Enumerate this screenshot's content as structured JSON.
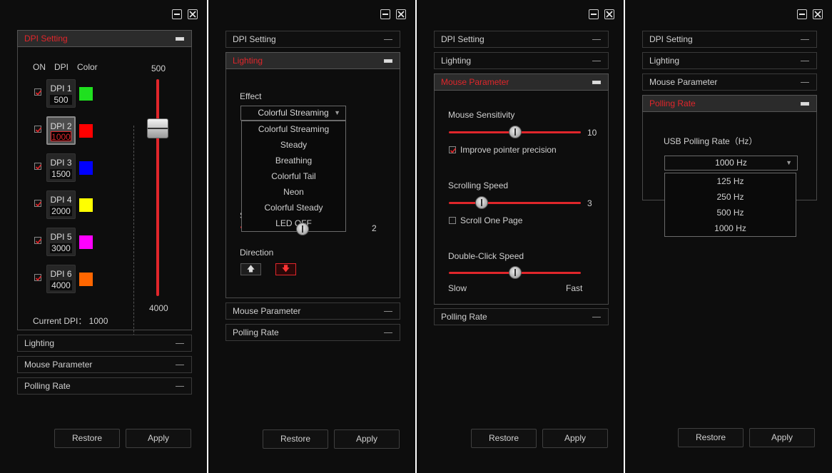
{
  "window": {
    "minimize_icon": "minimize-icon",
    "close_icon": "close-icon"
  },
  "colors": {
    "accent": "#e0262b",
    "background": "#0d0d0d"
  },
  "panel1": {
    "sections": {
      "dpi": "DPI Setting",
      "lighting": "Lighting",
      "mouse": "Mouse Parameter",
      "polling": "Polling Rate"
    },
    "col_on": "ON",
    "col_dpi": "DPI",
    "col_color": "Color",
    "dpi_levels": [
      {
        "name": "DPI 1",
        "value": "500",
        "color": "#1fe01f",
        "on": true
      },
      {
        "name": "DPI 2",
        "value": "1000",
        "color": "#ff0000",
        "on": true
      },
      {
        "name": "DPI 3",
        "value": "1500",
        "color": "#0000ff",
        "on": true
      },
      {
        "name": "DPI 4",
        "value": "2000",
        "color": "#ffff00",
        "on": true
      },
      {
        "name": "DPI 5",
        "value": "3000",
        "color": "#ff00ff",
        "on": true
      },
      {
        "name": "DPI 6",
        "value": "4000",
        "color": "#ff6600",
        "on": true
      }
    ],
    "slider_max": "500",
    "slider_min": "4000",
    "current_dpi": "Current DPI：  1000",
    "restore": "Restore",
    "apply": "Apply"
  },
  "panel2": {
    "sections": {
      "dpi": "DPI Setting",
      "lighting": "Lighting",
      "mouse": "Mouse Parameter",
      "polling": "Polling Rate"
    },
    "effect_label": "Effect",
    "effect_selected": "Colorful Streaming",
    "effect_options": [
      "Colorful Streaming",
      "Steady",
      "Breathing",
      "Colorful Tail",
      "Neon",
      "Colorful Steady",
      "LED OFF"
    ],
    "hidden_label_char": "S",
    "speed_value": "2",
    "direction_label": "Direction",
    "direction_up_icon": "arrow-up-icon",
    "direction_down_icon": "arrow-down-icon",
    "direction_up": "🡅",
    "direction_down": "🡇",
    "restore": "Restore",
    "apply": "Apply"
  },
  "panel3": {
    "sections": {
      "dpi": "DPI Setting",
      "lighting": "Lighting",
      "mouse": "Mouse Parameter",
      "polling": "Polling Rate"
    },
    "sensitivity_label": "Mouse Sensitivity",
    "sensitivity_value": "10",
    "sensitivity_fraction": 0.5,
    "precision_label": "Improve pointer precision",
    "precision_checked": true,
    "scroll_label": "Scrolling Speed",
    "scroll_value": "3",
    "scroll_fraction": 0.25,
    "scroll_one_page_label": "Scroll One Page",
    "scroll_one_page_checked": false,
    "dblclick_label": "Double-Click Speed",
    "dblclick_fraction": 0.5,
    "slow_label": "Slow",
    "fast_label": "Fast",
    "restore": "Restore",
    "apply": "Apply"
  },
  "panel4": {
    "sections": {
      "dpi": "DPI Setting",
      "lighting": "Lighting",
      "mouse": "Mouse Parameter",
      "polling": "Polling Rate"
    },
    "usb_label": "USB Polling Rate（Hz）",
    "selected": "1000 Hz",
    "options": [
      "125 Hz",
      "250 Hz",
      "500 Hz",
      "1000 Hz"
    ],
    "restore": "Restore",
    "apply": "Apply"
  }
}
